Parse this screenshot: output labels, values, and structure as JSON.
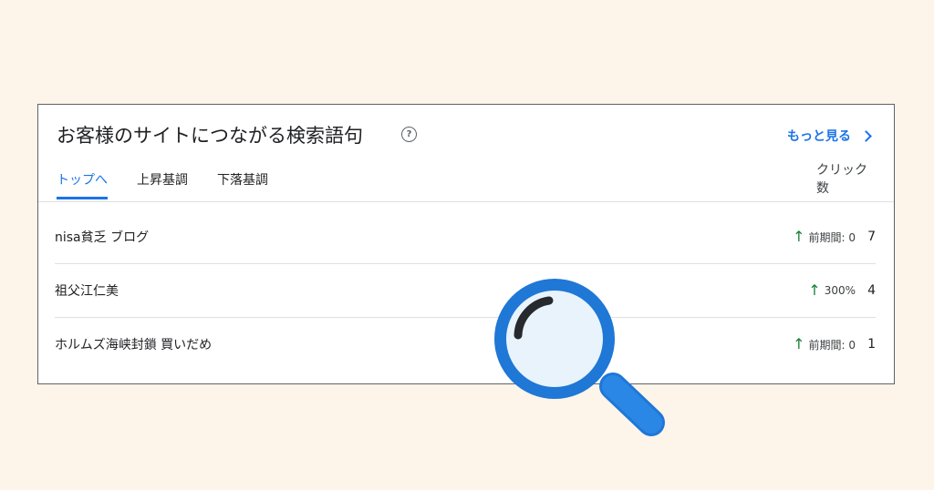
{
  "card": {
    "title": "お客様のサイトにつながる検索語句",
    "help_icon": "?",
    "more_label": "もっと見る"
  },
  "tabs": [
    {
      "label": "トップへ",
      "active": true
    },
    {
      "label": "上昇基調",
      "active": false
    },
    {
      "label": "下落基調",
      "active": false
    }
  ],
  "column_header": "クリック数",
  "rows": [
    {
      "term": "nisa貧乏 ブログ",
      "trend": "前期間: 0",
      "value": "7"
    },
    {
      "term": "祖父江仁美",
      "trend": "300%",
      "value": "4"
    },
    {
      "term": "ホルムズ海峡封鎖 買いだめ",
      "trend": "前期間: 0",
      "value": "1"
    }
  ],
  "icons": {
    "help": "help-circle-icon",
    "more": "chevron-right-icon",
    "trend": "arrow-up-icon",
    "overlay": "magnifying-glass-icon"
  },
  "colors": {
    "background": "#fdf4ea",
    "accent": "#1a73e8",
    "trend_up": "#188038",
    "magnifier_rim": "#1f77d6"
  }
}
